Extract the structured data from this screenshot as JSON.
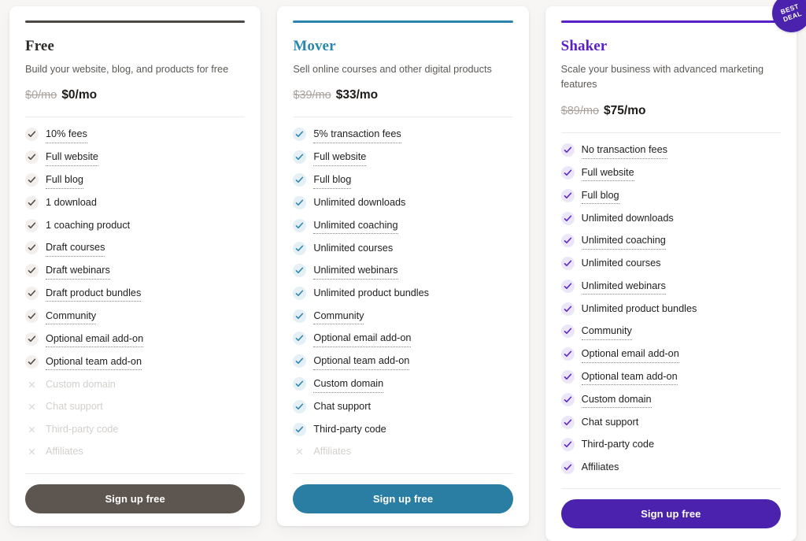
{
  "page": {
    "background_color": "#f7f6f5",
    "badge": {
      "line1": "BEST",
      "line2": "DEAL",
      "color": "#4a22ad"
    }
  },
  "plans": [
    {
      "id": "free",
      "name": "Free",
      "description": "Build your website, blog, and products for free",
      "price_old": "$0/mo",
      "price_new": "$0/mo",
      "accent_color": "#4d4843",
      "button_color": "#5d5650",
      "cta_label": "Sign up free",
      "features": [
        {
          "label": "10% fees",
          "included": true,
          "tooltip": true
        },
        {
          "label": "Full website",
          "included": true,
          "tooltip": true
        },
        {
          "label": "Full blog",
          "included": true,
          "tooltip": true
        },
        {
          "label": "1 download",
          "included": true,
          "tooltip": false
        },
        {
          "label": "1 coaching product",
          "included": true,
          "tooltip": false
        },
        {
          "label": "Draft courses",
          "included": true,
          "tooltip": true
        },
        {
          "label": "Draft webinars",
          "included": true,
          "tooltip": true
        },
        {
          "label": "Draft product bundles",
          "included": true,
          "tooltip": true
        },
        {
          "label": "Community",
          "included": true,
          "tooltip": true
        },
        {
          "label": "Optional email add-on",
          "included": true,
          "tooltip": true
        },
        {
          "label": "Optional team add-on",
          "included": true,
          "tooltip": true
        },
        {
          "label": "Custom domain",
          "included": false,
          "tooltip": false
        },
        {
          "label": "Chat support",
          "included": false,
          "tooltip": false
        },
        {
          "label": "Third-party code",
          "included": false,
          "tooltip": false
        },
        {
          "label": "Affiliates",
          "included": false,
          "tooltip": false
        }
      ]
    },
    {
      "id": "mover",
      "name": "Mover",
      "description": "Sell online courses and other digital products",
      "price_old": "$39/mo",
      "price_new": "$33/mo",
      "accent_color": "#2b86ad",
      "button_color": "#2b7ea3",
      "cta_label": "Sign up free",
      "features": [
        {
          "label": "5% transaction fees",
          "included": true,
          "tooltip": true
        },
        {
          "label": "Full website",
          "included": true,
          "tooltip": true
        },
        {
          "label": "Full blog",
          "included": true,
          "tooltip": true
        },
        {
          "label": "Unlimited downloads",
          "included": true,
          "tooltip": false
        },
        {
          "label": "Unlimited coaching",
          "included": true,
          "tooltip": true
        },
        {
          "label": "Unlimited courses",
          "included": true,
          "tooltip": false
        },
        {
          "label": "Unlimited webinars",
          "included": true,
          "tooltip": true
        },
        {
          "label": "Unlimited product bundles",
          "included": true,
          "tooltip": false
        },
        {
          "label": "Community",
          "included": true,
          "tooltip": true
        },
        {
          "label": "Optional email add-on",
          "included": true,
          "tooltip": true
        },
        {
          "label": "Optional team add-on",
          "included": true,
          "tooltip": true
        },
        {
          "label": "Custom domain",
          "included": true,
          "tooltip": true
        },
        {
          "label": "Chat support",
          "included": true,
          "tooltip": false
        },
        {
          "label": "Third-party code",
          "included": true,
          "tooltip": false
        },
        {
          "label": "Affiliates",
          "included": false,
          "tooltip": false
        }
      ]
    },
    {
      "id": "shaker",
      "name": "Shaker",
      "description": "Scale your business with advanced marketing features",
      "price_old": "$89/mo",
      "price_new": "$75/mo",
      "accent_color": "#5b21c9",
      "button_color": "#4a22ad",
      "cta_label": "Sign up free",
      "badge": true,
      "features": [
        {
          "label": "No transaction fees",
          "included": true,
          "tooltip": true
        },
        {
          "label": "Full website",
          "included": true,
          "tooltip": true
        },
        {
          "label": "Full blog",
          "included": true,
          "tooltip": true
        },
        {
          "label": "Unlimited downloads",
          "included": true,
          "tooltip": false
        },
        {
          "label": "Unlimited coaching",
          "included": true,
          "tooltip": true
        },
        {
          "label": "Unlimited courses",
          "included": true,
          "tooltip": false
        },
        {
          "label": "Unlimited webinars",
          "included": true,
          "tooltip": true
        },
        {
          "label": "Unlimited product bundles",
          "included": true,
          "tooltip": false
        },
        {
          "label": "Community",
          "included": true,
          "tooltip": true
        },
        {
          "label": "Optional email add-on",
          "included": true,
          "tooltip": true
        },
        {
          "label": "Optional team add-on",
          "included": true,
          "tooltip": true
        },
        {
          "label": "Custom domain",
          "included": true,
          "tooltip": true
        },
        {
          "label": "Chat support",
          "included": true,
          "tooltip": false
        },
        {
          "label": "Third-party code",
          "included": true,
          "tooltip": false
        },
        {
          "label": "Affiliates",
          "included": true,
          "tooltip": false
        }
      ]
    }
  ]
}
